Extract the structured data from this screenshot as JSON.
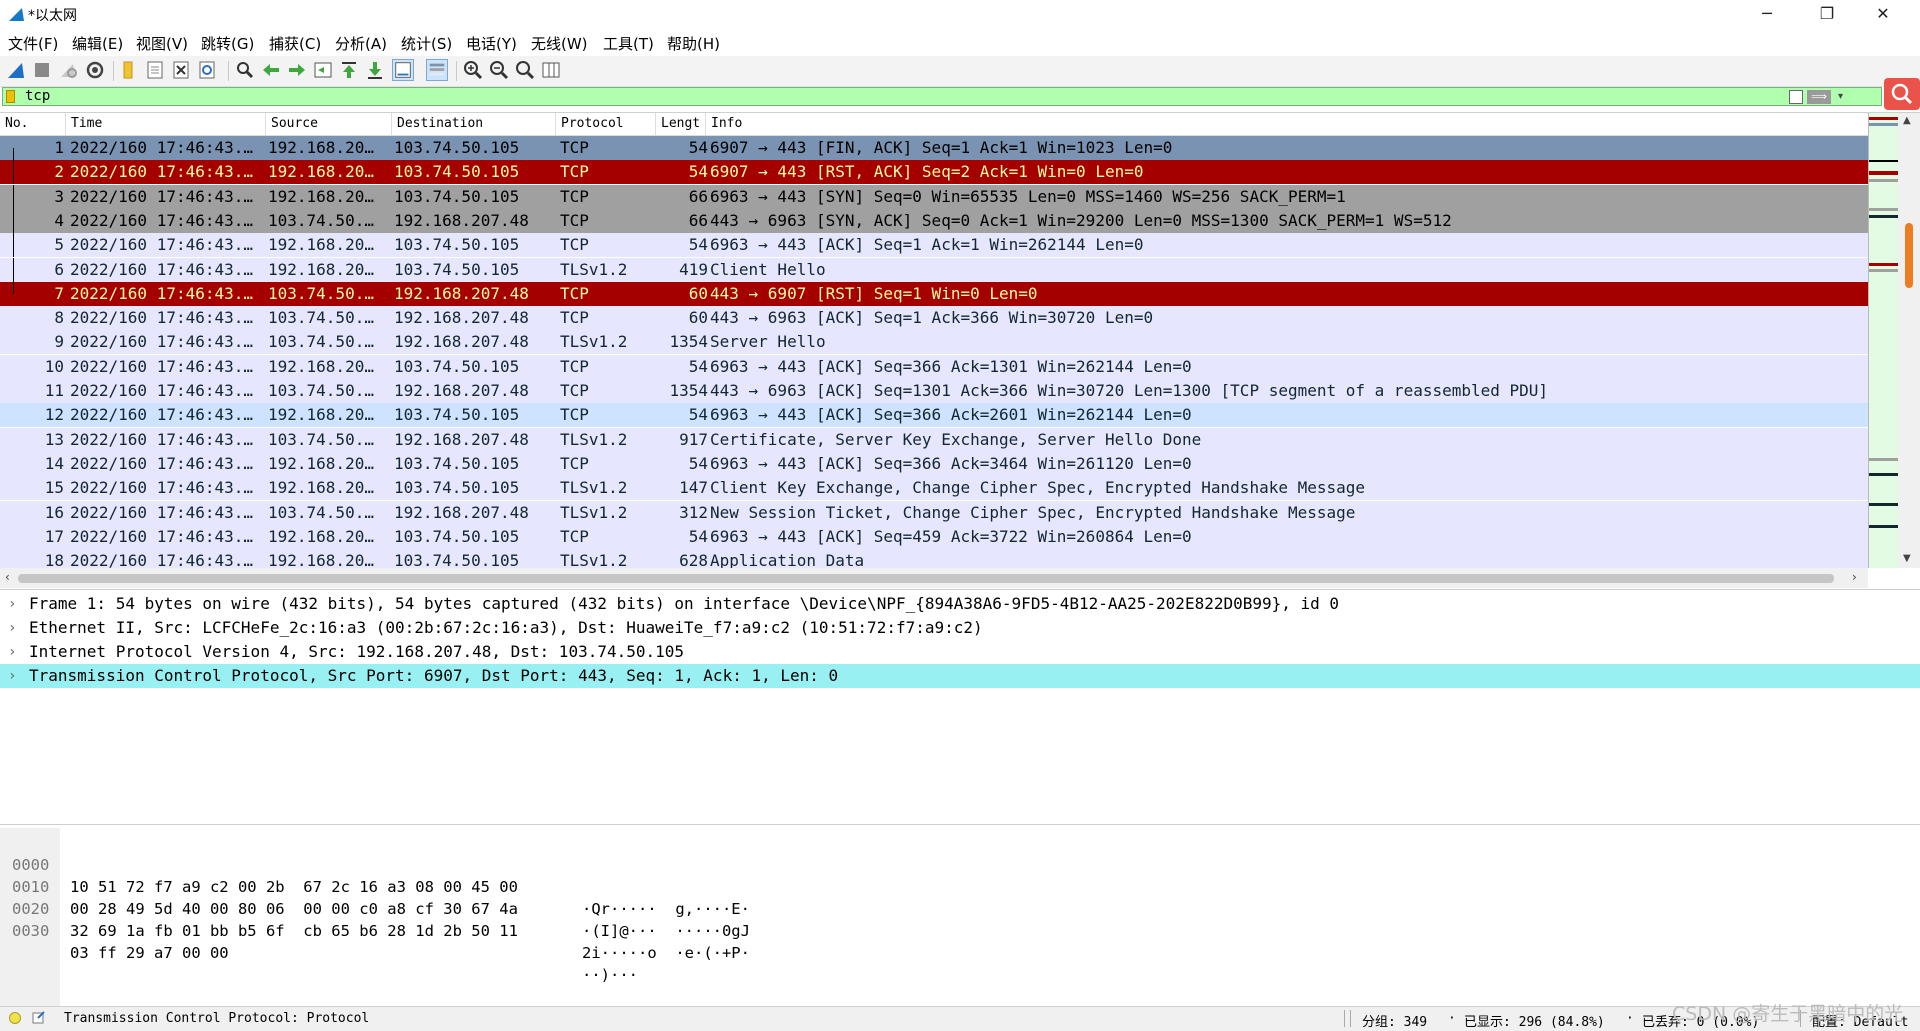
{
  "window": {
    "title": "*以太网",
    "minimize_glyph": "─",
    "restore_glyph": "❐",
    "close_glyph": "✕"
  },
  "menu": [
    "文件(F)",
    "编辑(E)",
    "视图(V)",
    "跳转(G)",
    "捕获(C)",
    "分析(A)",
    "统计(S)",
    "电话(Y)",
    "无线(W)",
    "工具(T)",
    "帮助(H)"
  ],
  "toolbar_icons": [
    "shark-fin-start-icon",
    "stop-square-icon",
    "restart-capture-icon",
    "capture-options-gear-icon",
    "open-file-icon",
    "save-file-icon",
    "close-file-icon",
    "reload-icon",
    "find-packet-icon",
    "go-back-arrow-icon",
    "go-forward-arrow-icon",
    "go-to-packet-icon",
    "go-first-packet-icon",
    "go-last-packet-icon",
    "auto-scroll-icon",
    "colorize-icon",
    "zoom-in-icon",
    "zoom-out-icon",
    "zoom-normal-icon",
    "resize-columns-icon"
  ],
  "filter": {
    "value": "tcp",
    "apply_label": "⟹",
    "plus_label": "+"
  },
  "columns": [
    "No.",
    "Time",
    "Source",
    "Destination",
    "Protocol",
    "Lengt",
    "Info"
  ],
  "packets": [
    {
      "no": "1",
      "time": "2022/160 17:46:43.…",
      "src": "192.168.20…",
      "dst": "103.74.50.105",
      "proto": "TCP",
      "len": "54",
      "info": "6907 → 443 [FIN, ACK] Seq=1 Ack=1 Win=1023 Len=0",
      "bg": "#7b93b2",
      "fg": "#000000"
    },
    {
      "no": "2",
      "time": "2022/160 17:46:43.…",
      "src": "192.168.20…",
      "dst": "103.74.50.105",
      "proto": "TCP",
      "len": "54",
      "info": "6907 → 443 [RST, ACK] Seq=2 Ack=1 Win=0 Len=0",
      "bg": "#a40000",
      "fg": "#fffc9c"
    },
    {
      "no": "3",
      "time": "2022/160 17:46:43.…",
      "src": "192.168.20…",
      "dst": "103.74.50.105",
      "proto": "TCP",
      "len": "66",
      "info": "6963 → 443 [SYN] Seq=0 Win=65535 Len=0 MSS=1460 WS=256 SACK_PERM=1",
      "bg": "#a0a0a0",
      "fg": "#000000"
    },
    {
      "no": "4",
      "time": "2022/160 17:46:43.…",
      "src": "103.74.50.…",
      "dst": "192.168.207.48",
      "proto": "TCP",
      "len": "66",
      "info": "443 → 6963 [SYN, ACK] Seq=0 Ack=1 Win=29200 Len=0 MSS=1300 SACK_PERM=1 WS=512",
      "bg": "#a0a0a0",
      "fg": "#000000"
    },
    {
      "no": "5",
      "time": "2022/160 17:46:43.…",
      "src": "192.168.20…",
      "dst": "103.74.50.105",
      "proto": "TCP",
      "len": "54",
      "info": "6963 → 443 [ACK] Seq=1 Ack=1 Win=262144 Len=0",
      "bg": "#e7e6ff",
      "fg": "#12272e"
    },
    {
      "no": "6",
      "time": "2022/160 17:46:43.…",
      "src": "192.168.20…",
      "dst": "103.74.50.105",
      "proto": "TLSv1.2",
      "len": "419",
      "info": "Client Hello",
      "bg": "#e7e6ff",
      "fg": "#12272e"
    },
    {
      "no": "7",
      "time": "2022/160 17:46:43.…",
      "src": "103.74.50.…",
      "dst": "192.168.207.48",
      "proto": "TCP",
      "len": "60",
      "info": "443 → 6907 [RST] Seq=1 Win=0 Len=0",
      "bg": "#a40000",
      "fg": "#fffc9c"
    },
    {
      "no": "8",
      "time": "2022/160 17:46:43.…",
      "src": "103.74.50.…",
      "dst": "192.168.207.48",
      "proto": "TCP",
      "len": "60",
      "info": "443 → 6963 [ACK] Seq=1 Ack=366 Win=30720 Len=0",
      "bg": "#e7e6ff",
      "fg": "#12272e"
    },
    {
      "no": "9",
      "time": "2022/160 17:46:43.…",
      "src": "103.74.50.…",
      "dst": "192.168.207.48",
      "proto": "TLSv1.2",
      "len": "1354",
      "info": "Server Hello",
      "bg": "#e7e6ff",
      "fg": "#12272e"
    },
    {
      "no": "10",
      "time": "2022/160 17:46:43.…",
      "src": "192.168.20…",
      "dst": "103.74.50.105",
      "proto": "TCP",
      "len": "54",
      "info": "6963 → 443 [ACK] Seq=366 Ack=1301 Win=262144 Len=0",
      "bg": "#e7e6ff",
      "fg": "#12272e"
    },
    {
      "no": "11",
      "time": "2022/160 17:46:43.…",
      "src": "103.74.50.…",
      "dst": "192.168.207.48",
      "proto": "TCP",
      "len": "1354",
      "info": "443 → 6963 [ACK] Seq=1301 Ack=366 Win=30720 Len=1300 [TCP segment of a reassembled PDU]",
      "bg": "#e7e6ff",
      "fg": "#12272e"
    },
    {
      "no": "12",
      "time": "2022/160 17:46:43.…",
      "src": "192.168.20…",
      "dst": "103.74.50.105",
      "proto": "TCP",
      "len": "54",
      "info": "6963 → 443 [ACK] Seq=366 Ack=2601 Win=262144 Len=0",
      "bg": "#cde3ff",
      "fg": "#12272e"
    },
    {
      "no": "13",
      "time": "2022/160 17:46:43.…",
      "src": "103.74.50.…",
      "dst": "192.168.207.48",
      "proto": "TLSv1.2",
      "len": "917",
      "info": "Certificate, Server Key Exchange, Server Hello Done",
      "bg": "#e7e6ff",
      "fg": "#12272e"
    },
    {
      "no": "14",
      "time": "2022/160 17:46:43.…",
      "src": "192.168.20…",
      "dst": "103.74.50.105",
      "proto": "TCP",
      "len": "54",
      "info": "6963 → 443 [ACK] Seq=366 Ack=3464 Win=261120 Len=0",
      "bg": "#e7e6ff",
      "fg": "#12272e"
    },
    {
      "no": "15",
      "time": "2022/160 17:46:43.…",
      "src": "192.168.20…",
      "dst": "103.74.50.105",
      "proto": "TLSv1.2",
      "len": "147",
      "info": "Client Key Exchange, Change Cipher Spec, Encrypted Handshake Message",
      "bg": "#e7e6ff",
      "fg": "#12272e"
    },
    {
      "no": "16",
      "time": "2022/160 17:46:43.…",
      "src": "103.74.50.…",
      "dst": "192.168.207.48",
      "proto": "TLSv1.2",
      "len": "312",
      "info": "New Session Ticket, Change Cipher Spec, Encrypted Handshake Message",
      "bg": "#e7e6ff",
      "fg": "#12272e"
    },
    {
      "no": "17",
      "time": "2022/160 17:46:43.…",
      "src": "192.168.20…",
      "dst": "103.74.50.105",
      "proto": "TCP",
      "len": "54",
      "info": "6963 → 443 [ACK] Seq=459 Ack=3722 Win=260864 Len=0",
      "bg": "#e7e6ff",
      "fg": "#12272e"
    },
    {
      "no": "18",
      "time": "2022/160 17:46:43.…",
      "src": "192.168.20…",
      "dst": "103.74.50.105",
      "proto": "TLSv1.2",
      "len": "628",
      "info": "Application Data",
      "bg": "#e7e6ff",
      "fg": "#12272e"
    }
  ],
  "details": [
    "Frame 1: 54 bytes on wire (432 bits), 54 bytes captured (432 bits) on interface \\Device\\NPF_{894A38A6-9FD5-4B12-AA25-202E822D0B99}, id 0",
    "Ethernet II, Src: LCFCHeFe_2c:16:a3 (00:2b:67:2c:16:a3), Dst: HuaweiTe_f7:a9:c2 (10:51:72:f7:a9:c2)",
    "Internet Protocol Version 4, Src: 192.168.207.48, Dst: 103.74.50.105",
    "Transmission Control Protocol, Src Port: 6907, Dst Port: 443, Seq: 1, Ack: 1, Len: 0"
  ],
  "details_arrow": "›",
  "bytes": [
    {
      "offset": "0000",
      "hex": "10 51 72 f7 a9 c2 00 2b  67 2c 16 a3 08 00 45 00",
      "ascii": "·Qr·····  g,····E·"
    },
    {
      "offset": "0010",
      "hex": "00 28 49 5d 40 00 80 06  00 00 c0 a8 cf 30 67 4a",
      "ascii": "·(I]@···  ·····0gJ"
    },
    {
      "offset": "0020",
      "hex": "32 69 1a fb 01 bb b5 6f  cb 65 b6 28 1d 2b 50 11",
      "ascii": "2i·····o  ·e·(·+P·"
    },
    {
      "offset": "0030",
      "hex": "03 ff 29 a7 00 00",
      "ascii": "··)···"
    }
  ],
  "status": {
    "field": "Transmission Control Protocol: Protocol",
    "packets": "分组: 349",
    "displayed": "已显示: 296 (84.8%)",
    "dropped": "已丢弃: 0 (0.0%)",
    "profile": "配置: Default"
  },
  "watermark": "CSDN @寄生于黑暗中的光"
}
